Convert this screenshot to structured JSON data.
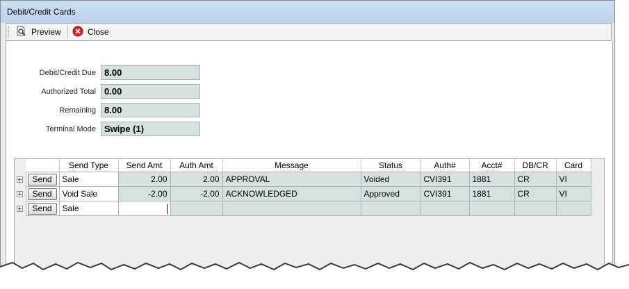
{
  "window": {
    "title": "Debit/Credit Cards"
  },
  "toolbar": {
    "preview_label": "Preview",
    "close_label": "Close"
  },
  "summary": {
    "due_label": "Debit/Credit Due",
    "due_value": "8.00",
    "auth_label": "Authorized Total",
    "auth_value": "0.00",
    "remaining_label": "Remaining",
    "remaining_value": "8.00",
    "terminal_label": "Terminal Mode",
    "terminal_value": "Swipe (1)"
  },
  "grid": {
    "columns": [
      "Send Type",
      "Send Amt",
      "Auth Amt",
      "Message",
      "Status",
      "Auth#",
      "Acct#",
      "DB/CR",
      "Card"
    ],
    "send_label": "Send",
    "rows": [
      {
        "send_type": "Sale",
        "send_amt": "2.00",
        "auth_amt": "2.00",
        "message": "APPROVAL",
        "status": "Voided",
        "auth_no": "CVI391",
        "acct_no": "1881",
        "dbcr": "CR",
        "card": "VI"
      },
      {
        "send_type": "Void Sale",
        "send_amt": "-2.00",
        "auth_amt": "-2.00",
        "message": "ACKNOWLEDGED",
        "status": "Approved",
        "auth_no": "CVI391",
        "acct_no": "1881",
        "dbcr": "CR",
        "card": "VI"
      },
      {
        "send_type": "Sale",
        "send_amt": "",
        "auth_amt": "",
        "message": "",
        "status": "",
        "auth_no": "",
        "acct_no": "",
        "dbcr": "",
        "card": ""
      }
    ]
  },
  "colors": {
    "field_bg": "#d4e1df",
    "titlebar": "#bcd3ec",
    "close_icon": "#d42020"
  }
}
